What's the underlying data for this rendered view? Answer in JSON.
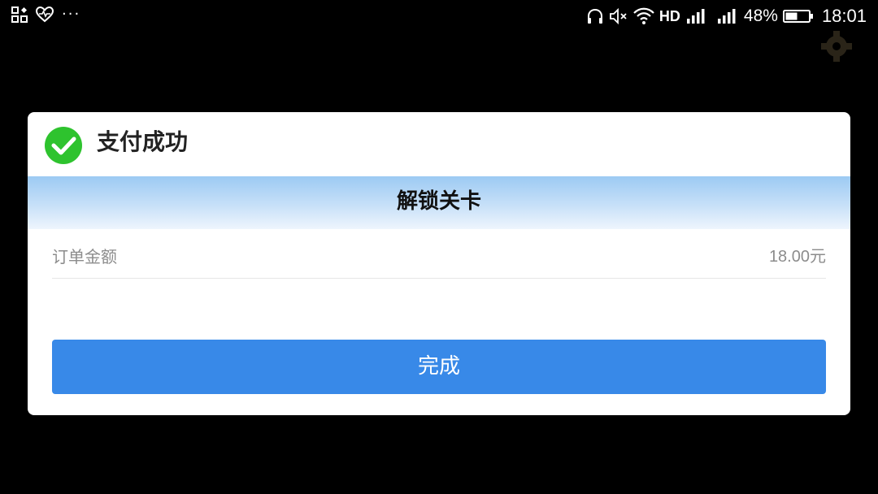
{
  "status_bar": {
    "notif_dots": "···",
    "hd_label": "HD",
    "battery_percent": "48%",
    "time": "18:01",
    "icons": [
      "qr-scan-icon",
      "heart-health-icon",
      "headphones-icon",
      "mute-icon",
      "wifi-icon",
      "signal-icon",
      "battery-icon"
    ]
  },
  "dialog": {
    "title": "支付成功",
    "banner_text": "解锁关卡",
    "order_label": "订单金额",
    "order_value": "18.00元",
    "done_label": "完成"
  },
  "colors": {
    "background": "#000000",
    "dialog_bg": "#ffffff",
    "success_green": "#2ec32e",
    "button_blue": "#3889e8",
    "banner_top": "#9ccaf3",
    "banner_bottom": "#eef5fd"
  }
}
